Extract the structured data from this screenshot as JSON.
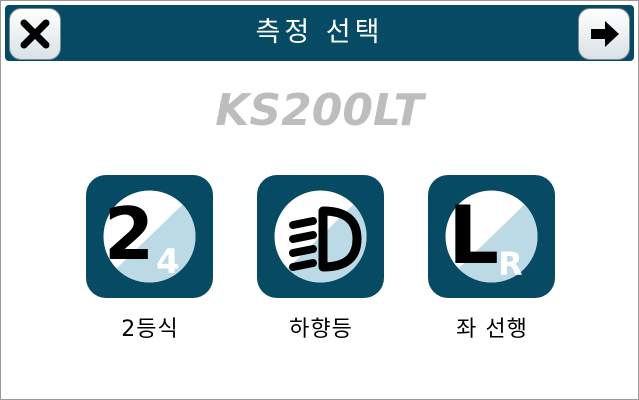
{
  "header": {
    "title": "측정 선택",
    "close_icon": "close-icon",
    "next_icon": "arrow-right-icon"
  },
  "model": "KS200LT",
  "options": [
    {
      "label": "2등식",
      "icon": "two-lamp-icon",
      "glyph": "2",
      "sub": "4"
    },
    {
      "label": "하향등",
      "icon": "low-beam-icon"
    },
    {
      "label": "좌 선행",
      "icon": "left-traffic-icon",
      "glyph": "L",
      "sub": "R"
    }
  ],
  "colors": {
    "header_bg": "#064b63",
    "tile_bg": "#064b63",
    "tile_diag": "#bcd9e6",
    "model_text": "#bdbdbd"
  }
}
